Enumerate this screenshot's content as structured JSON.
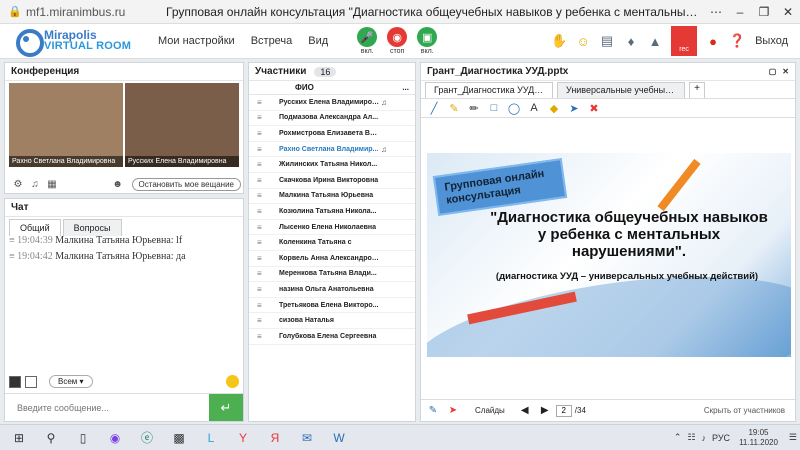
{
  "browser": {
    "url": "mf1.miranimbus.ru",
    "title": "Групповая онлайн консультация \"Диагностика общеучебных навыков у ребенка с ментальными нарушения...",
    "icons": [
      "lock-icon",
      "menu-dots-icon",
      "minimize-icon",
      "restore-icon",
      "close-icon"
    ]
  },
  "header": {
    "logo_top": "Mirapolis",
    "logo_bottom": "VIRTUAL ROOM",
    "menu": [
      "Мои настройки",
      "Встреча",
      "Вид"
    ],
    "mic_label": "вкл.",
    "stop_label": "стоп",
    "cam_label": "вкл.",
    "rec_label": "rec",
    "exit": "Выход"
  },
  "conference": {
    "title": "Конференция",
    "videos": [
      {
        "caption": "Рахно Светлана Владимировна"
      },
      {
        "caption": "Русских Елена Владимировна"
      }
    ],
    "stop_broadcast": "Остановить мое вещание"
  },
  "chat": {
    "title": "Чат",
    "tabs": [
      "Общий",
      "Вопросы"
    ],
    "messages": [
      {
        "time": "19:04:39",
        "author": "Малкина Татьяна  Юрьевна:",
        "text": "lf"
      },
      {
        "time": "19:04:42",
        "author": "Малкина Татьяна  Юрьевна:",
        "text": "да"
      }
    ],
    "recipient": "Всем",
    "input_placeholder": "Введите сообщение..."
  },
  "participants": {
    "title": "Участники",
    "count": "16",
    "column": "ФИО",
    "more": "...",
    "rows": [
      "Русских Елена Владимировна",
      "Подмазова Александра Ал...",
      "Рохмистрова  Елизавета Вл...",
      "Рахно Светлана  Владимир...",
      "Жилинских  Татьяна  Никол...",
      "Скачкова Ирина Викторовна",
      "Малкина Татьяна  Юрьевна",
      "Козюлина  Татьяна Никола...",
      "Лысенко Елена Николаевна",
      "Коленкина  Татьяна  с",
      "Корвель Анна  Александров...",
      "Меренкова  Татьяна  Влади...",
      "назина  Ольга Анатольевна",
      "Третьякова  Елена Викторо...",
      "сизова  Наталья",
      "Голубкова  Елена Сергеевна"
    ]
  },
  "presentation": {
    "title": "Грант_Диагностика УУД.pptx",
    "tabs": [
      "Грант_Диагностика УУД....",
      "Универсальные учебные..."
    ],
    "add": "+",
    "slide": {
      "banner_line1": "Групповая онлайн",
      "banner_line2": "консультация",
      "heading": "\"Диагностика общеучебных навыков у ребенка с ментальных нарушениями\".",
      "sub": "(диагностика УУД – универсальных учебных действий)"
    },
    "slides_label": "Слайды",
    "page": "2",
    "total": "/34",
    "hide_label": "Скрыть от участников"
  },
  "taskbar": {
    "lang": "РУС",
    "time": "19:05",
    "date": "11.11.2020"
  }
}
